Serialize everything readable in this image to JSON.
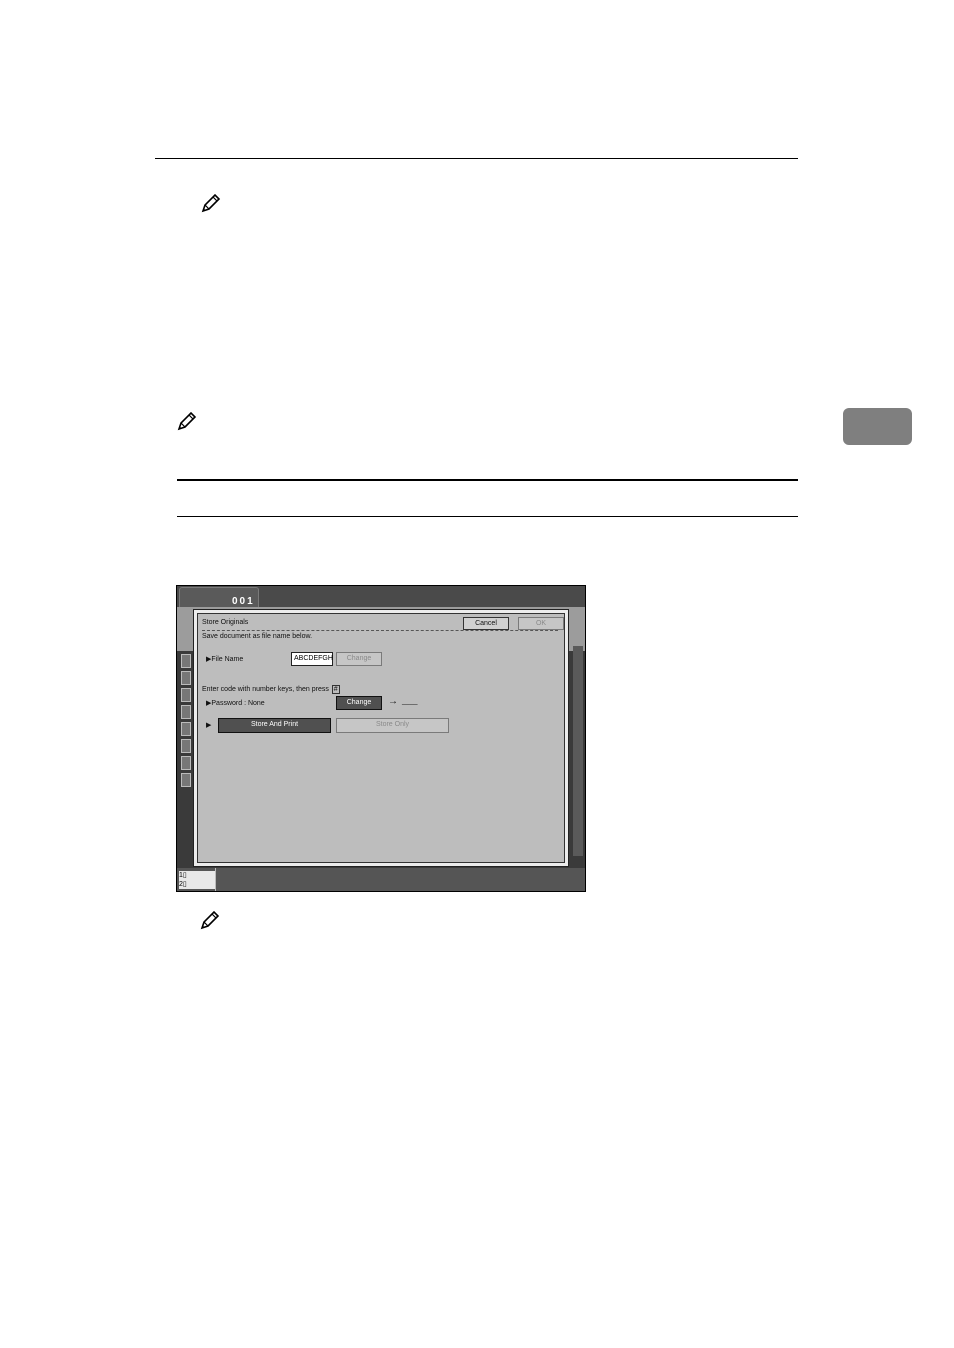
{
  "screen": {
    "tab_number": "001",
    "dialog_title": "Store Originals",
    "cancel_label": "Cancel",
    "ok_label": "OK",
    "instruction": "Save document as file name below.",
    "file_name_label": "▶File Name",
    "file_name_value": "ABCDEFGH",
    "file_name_change": "Change",
    "password_instruction": "Enter code with number keys, then press",
    "password_key_symbol": "#",
    "password_label": "▶Password : None",
    "password_change": "Change",
    "password_arrow": "→",
    "password_value": "____",
    "store_mode_marker": "▶",
    "store_and_print": "Store And Print",
    "store_only": "Store Only",
    "bottom_indicator_1": "1▯",
    "bottom_indicator_2": "2▯"
  }
}
